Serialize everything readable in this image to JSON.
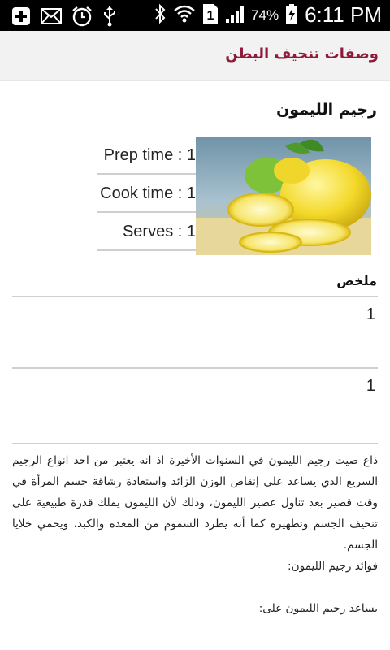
{
  "status_bar": {
    "icons_left": [
      "add-icon",
      "mail-icon",
      "alarm-icon",
      "usb-icon"
    ],
    "icons_right": [
      "bluetooth-icon",
      "wifi-icon",
      "sim-icon",
      "signal-icon"
    ],
    "battery_percent": "74%",
    "time": "6:11 PM"
  },
  "action_bar": {
    "title": "وصفات تنحيف البطن"
  },
  "recipe": {
    "title": "رجيم الليمون",
    "prep_time": "Prep time : 1",
    "cook_time": "Cook time : 1",
    "serves": "Serves : 1",
    "image_icon": "lemons-image"
  },
  "summary": {
    "label": "ملخص",
    "items": [
      "1",
      "1"
    ]
  },
  "description": {
    "paragraph": "ذاع صيت رجيم الليمون في السنوات الأخيرة اذ انه يعتبر من احد انواع الرجيم السريع الذي يساعد على إنقاص الوزن الزائد واستعادة رشاقة جسم المرأة في وقت قصير بعد تناول عصير الليمون، وذلك لأن الليمون يملك قدرة طبيعية على تنحيف الجسم وتطهيره كما أنه يطرد السموم من المعدة والكبد، ويحمي خلايا الجسم.",
    "benefits_heading": "فوائد رجيم الليمون:",
    "helps_heading": "يساعد رجيم الليمون على:"
  },
  "colors": {
    "accent": "#8e1b3a",
    "divider": "#cfcfcf"
  }
}
